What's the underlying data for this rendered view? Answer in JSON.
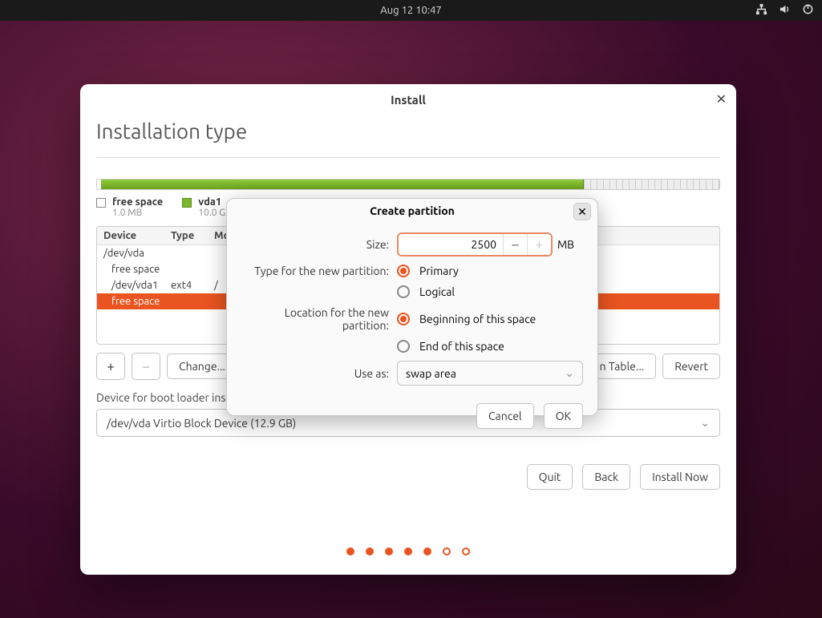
{
  "topbar": {
    "datetime": "Aug 12  10:47"
  },
  "window": {
    "title": "Install",
    "heading": "Installation type",
    "legend": [
      {
        "name": "free space",
        "sub": "1.0 MB"
      },
      {
        "name": "vda1",
        "sub": "10.0 G"
      }
    ],
    "diskbar": {
      "free1_pct": 0.6,
      "vda1_pct": 77.6,
      "free2_pct": 21.8
    },
    "table": {
      "headers": [
        "Device",
        "Type",
        "Mo"
      ],
      "rows": [
        {
          "cells": [
            "/dev/vda",
            "",
            ""
          ],
          "indent": false,
          "selected": false
        },
        {
          "cells": [
            "free space",
            "",
            ""
          ],
          "indent": true,
          "selected": false
        },
        {
          "cells": [
            "/dev/vda1",
            "ext4",
            "/"
          ],
          "indent": true,
          "selected": false
        },
        {
          "cells": [
            "free space",
            "",
            ""
          ],
          "indent": true,
          "selected": true
        }
      ]
    },
    "buttons": {
      "add": "+",
      "remove": "−",
      "change": "Change...",
      "new_table": "n Table...",
      "revert": "Revert"
    },
    "boot_label": "Device for boot loader installation:",
    "boot_value": "/dev/vda   Virtio Block Device (12.9 GB)",
    "footer": {
      "quit": "Quit",
      "back": "Back",
      "install": "Install Now"
    }
  },
  "dialog": {
    "title": "Create partition",
    "size_label": "Size:",
    "size_value": "2500",
    "size_unit": "MB",
    "type_label": "Type for the new partition:",
    "type_primary": "Primary",
    "type_logical": "Logical",
    "loc_label": "Location for the new partition:",
    "loc_begin": "Beginning of this space",
    "loc_end": "End of this space",
    "use_label": "Use as:",
    "use_value": "swap area",
    "cancel": "Cancel",
    "ok": "OK"
  }
}
